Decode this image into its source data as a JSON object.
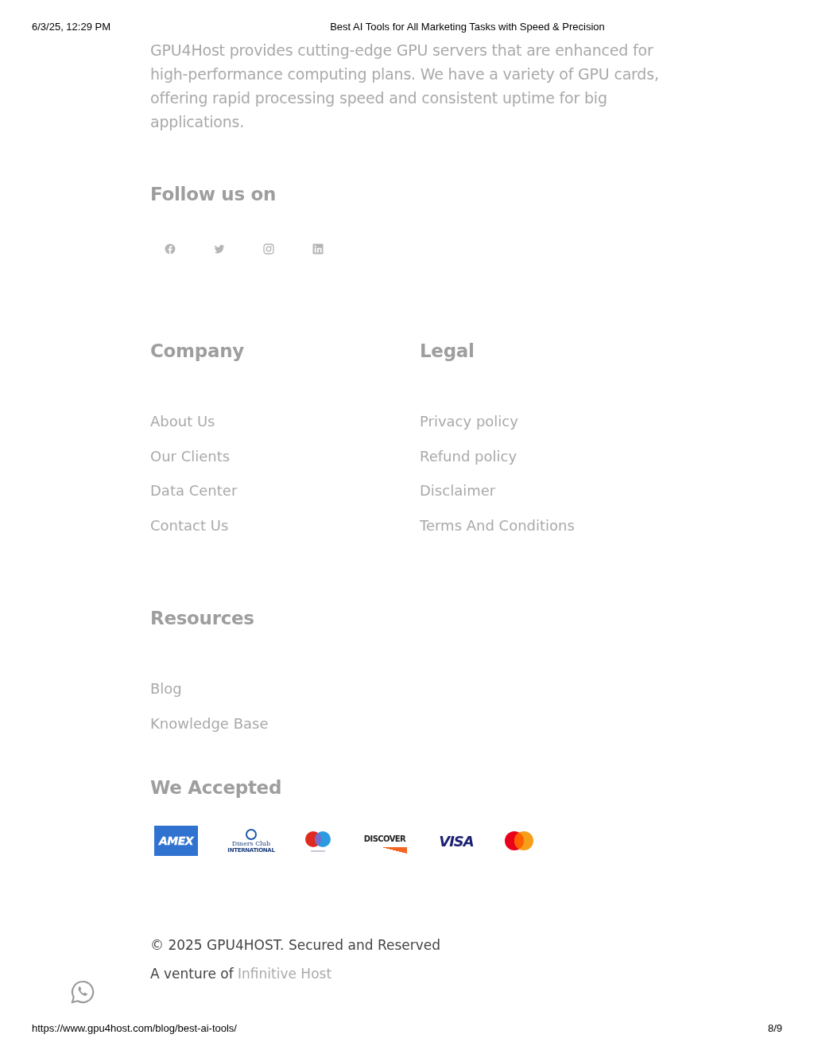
{
  "print_header": {
    "date": "6/3/25, 12:29 PM",
    "title": "Best AI Tools for All Marketing Tasks with Speed & Precision"
  },
  "about": {
    "text": "GPU4Host provides cutting-edge GPU servers that are enhanced for high-performance computing plans. We have a variety of GPU cards, offering rapid processing speed and consistent uptime for big applications."
  },
  "follow": {
    "title": "Follow us on",
    "social": [
      {
        "kind": "facebook"
      },
      {
        "kind": "twitter"
      },
      {
        "kind": "instagram"
      },
      {
        "kind": "linkedin"
      }
    ]
  },
  "columns": [
    {
      "title": "Company",
      "links": [
        "About Us",
        "Our Clients",
        "Data Center",
        "Contact Us"
      ]
    },
    {
      "title": "Legal",
      "links": [
        "Privacy policy",
        "Refund policy",
        "Disclaimer",
        "Terms And Conditions"
      ]
    }
  ],
  "resources": {
    "title": "Resources",
    "links": [
      "Blog",
      "Knowledge Base"
    ]
  },
  "payments": {
    "title": "We Accepted",
    "cards": [
      {
        "kind": "amex",
        "label": "AMEX"
      },
      {
        "kind": "diners",
        "label": "Diners Club",
        "sublabel": "INTERNATIONAL"
      },
      {
        "kind": "maestro"
      },
      {
        "kind": "discover",
        "label": "DISCOVER"
      },
      {
        "kind": "visa",
        "label": "VISA"
      },
      {
        "kind": "mastercard"
      }
    ]
  },
  "copyright": {
    "text": "© 2025 GPU4HOST. Secured and Reserved",
    "venture": "A venture of",
    "venture_link": "Infinitive Host"
  },
  "print_footer": {
    "url": "https://www.gpu4host.com/blog/best-ai-tools/",
    "page": "8/9"
  }
}
